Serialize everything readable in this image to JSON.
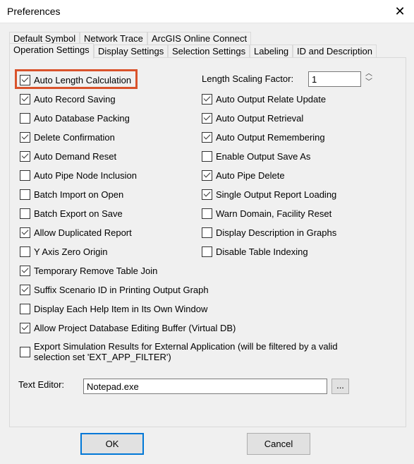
{
  "window": {
    "title": "Preferences",
    "close_icon": "close-icon"
  },
  "tabs_row1": [
    "Default Symbol",
    "Network Trace",
    "ArcGIS Online Connect"
  ],
  "tabs_row2": [
    "Operation Settings",
    "Display Settings",
    "Selection Settings",
    "Labeling",
    "ID and Description"
  ],
  "active_tab": "Operation Settings",
  "left_options": [
    {
      "label": "Auto Length Calculation",
      "checked": true
    },
    {
      "label": "Auto Record Saving",
      "checked": true
    },
    {
      "label": "Auto Database Packing",
      "checked": false
    },
    {
      "label": "Delete Confirmation",
      "checked": true
    },
    {
      "label": "Auto Demand Reset",
      "checked": true
    },
    {
      "label": "Auto Pipe Node Inclusion",
      "checked": false
    },
    {
      "label": "Batch Import on Open",
      "checked": false
    },
    {
      "label": "Batch Export on Save",
      "checked": false
    },
    {
      "label": "Allow Duplicated Report",
      "checked": true
    },
    {
      "label": "Y Axis Zero Origin",
      "checked": false
    },
    {
      "label": "Temporary Remove Table Join",
      "checked": true
    },
    {
      "label": "Suffix Scenario ID in Printing Output Graph",
      "checked": true
    },
    {
      "label": "Display Each Help Item in Its Own Window",
      "checked": false
    },
    {
      "label": "Allow Project Database Editing Buffer (Virtual DB)",
      "checked": true
    },
    {
      "label": "Export Simulation Results for External Application (will be filtered by a valid selection set 'EXT_APP_FILTER')",
      "checked": false
    }
  ],
  "right_options": [
    {
      "label": "Auto Output Relate Update",
      "checked": true
    },
    {
      "label": "Auto Output Retrieval",
      "checked": true
    },
    {
      "label": "Auto Output Remembering",
      "checked": true
    },
    {
      "label": "Enable Output Save As",
      "checked": false
    },
    {
      "label": "Auto Pipe Delete",
      "checked": true
    },
    {
      "label": "Single Output Report Loading",
      "checked": true
    },
    {
      "label": "Warn Domain, Facility Reset",
      "checked": false
    },
    {
      "label": "Display Description in Graphs",
      "checked": false
    },
    {
      "label": "Disable Table Indexing",
      "checked": false
    }
  ],
  "scaling": {
    "label": "Length Scaling Factor:",
    "value": "1"
  },
  "text_editor": {
    "label": "Text Editor:",
    "value": "Notepad.exe",
    "browse_label": "..."
  },
  "buttons": {
    "ok": "OK",
    "cancel": "Cancel"
  },
  "colors": {
    "highlight": "#d9532c",
    "focus": "#0078d7"
  }
}
